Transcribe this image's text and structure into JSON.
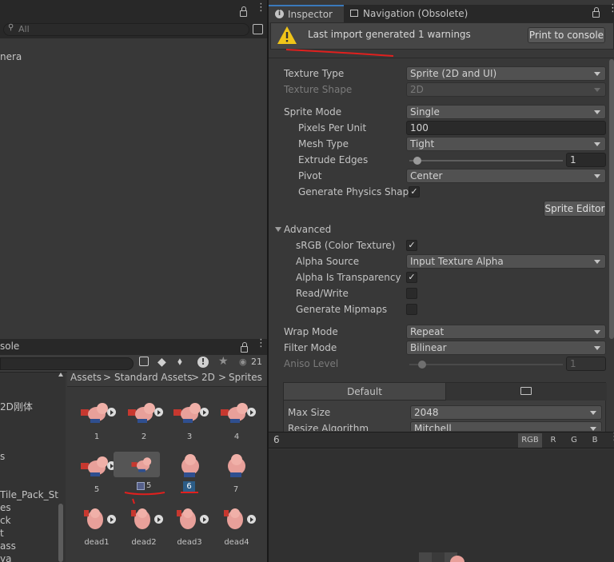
{
  "hierarchy": {
    "search_placeholder": "All",
    "items": [
      "nera"
    ]
  },
  "console_tab": {
    "label": "sole",
    "count": "21"
  },
  "project": {
    "tree_items": [
      "2D刚体",
      "s",
      "Tile_Pack_St",
      "es",
      "ck",
      "t",
      "ass",
      "ya"
    ],
    "breadcrumb": [
      "Assets",
      "Standard Assets",
      "2D",
      "Sprites"
    ],
    "breadcrumb_sep": ">",
    "sprites": [
      {
        "label": "1"
      },
      {
        "label": "2"
      },
      {
        "label": "3"
      },
      {
        "label": "4"
      },
      {
        "label": "5"
      },
      {
        "label": "5"
      },
      {
        "label": "6"
      },
      {
        "label": "7"
      },
      {
        "label": "dead1"
      },
      {
        "label": "dead2"
      },
      {
        "label": "dead3"
      },
      {
        "label": "dead4"
      }
    ]
  },
  "inspector": {
    "tabs": [
      "Inspector",
      "Navigation (Obsolete)"
    ],
    "warning_text": "Last import generated 1 warnings",
    "print_button": "Print to console",
    "texture_type_label": "Texture Type",
    "texture_type_value": "Sprite (2D and UI)",
    "texture_shape_label": "Texture Shape",
    "texture_shape_value": "2D",
    "sprite_mode_label": "Sprite Mode",
    "sprite_mode_value": "Single",
    "ppu_label": "Pixels Per Unit",
    "ppu_value": "100",
    "mesh_type_label": "Mesh Type",
    "mesh_type_value": "Tight",
    "extrude_label": "Extrude Edges",
    "extrude_value": "1",
    "extrude_fraction": 0.03,
    "pivot_label": "Pivot",
    "pivot_value": "Center",
    "physics_label": "Generate Physics Shape",
    "physics_checked": "✓",
    "sprite_editor_button": "Sprite Editor",
    "advanced_label": "Advanced",
    "srgb_label": "sRGB (Color Texture)",
    "srgb_checked": "✓",
    "alpha_source_label": "Alpha Source",
    "alpha_source_value": "Input Texture Alpha",
    "alpha_transp_label": "Alpha Is Transparency",
    "alpha_transp_checked": "✓",
    "readwrite_label": "Read/Write",
    "mipmaps_label": "Generate Mipmaps",
    "wrap_label": "Wrap Mode",
    "wrap_value": "Repeat",
    "filter_label": "Filter Mode",
    "filter_value": "Bilinear",
    "aniso_label": "Aniso Level",
    "aniso_value": "1",
    "aniso_fraction": 0.06,
    "platform_default": "Default",
    "max_size_label": "Max Size",
    "max_size_value": "2048",
    "resize_label": "Resize Algorithm",
    "resize_value": "Mitchell",
    "preview_name": "6",
    "channels": [
      "RGB",
      "R",
      "G",
      "B"
    ]
  },
  "colors": {
    "accent": "#3a79bb",
    "warning": "#f0c419",
    "annotation": "#e0201e",
    "selection": "#2c5d87"
  }
}
